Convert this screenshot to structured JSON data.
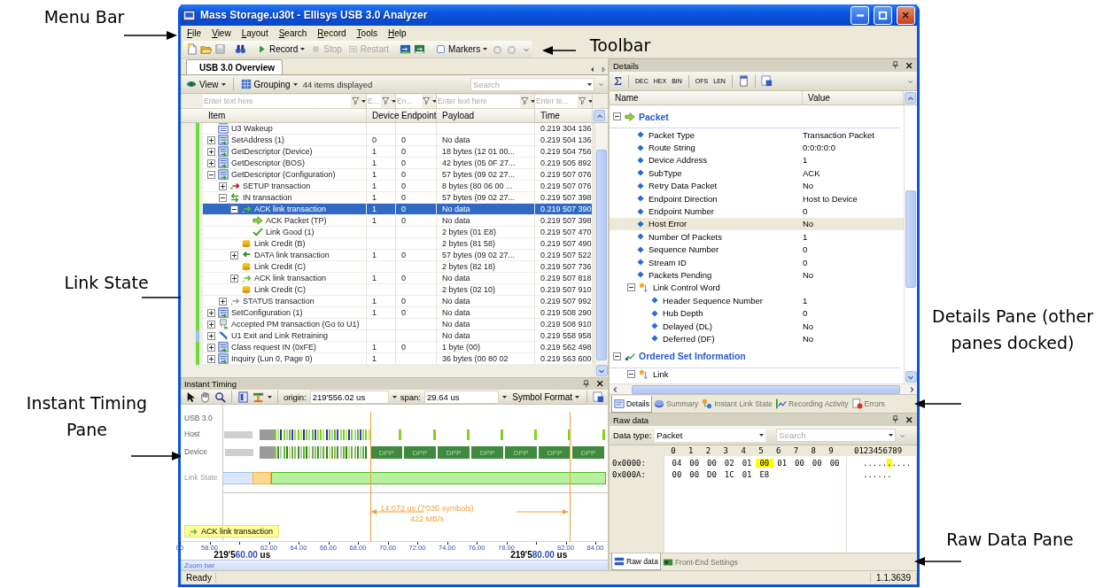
{
  "callouts": [
    {
      "text": "Menu Bar"
    },
    {
      "text": "Toolbar"
    },
    {
      "text": "Link State"
    },
    {
      "text": "Instant Timing Pane"
    },
    {
      "text": "Details Pane (other panes docked)"
    },
    {
      "text": "Raw Data Pane"
    }
  ],
  "window": {
    "title": "Mass Storage.u30t - Ellisys USB 3.0 Analyzer"
  },
  "menu": [
    "File",
    "View",
    "Layout",
    "Search",
    "Record",
    "Tools",
    "Help"
  ],
  "toolbar": [
    {
      "label": "Record",
      "disabled": false,
      "dropdown": true
    },
    {
      "label": "Stop",
      "disabled": true,
      "dropdown": false
    },
    {
      "label": "Restart",
      "disabled": true,
      "dropdown": false
    },
    {
      "label": "Markers",
      "disabled": false,
      "dropdown": true
    }
  ],
  "overview": {
    "tab": "USB 3.0 Overview",
    "view": "View",
    "grouping": "Grouping",
    "count": "44 items displayed",
    "search": {
      "placeholder": "Search"
    },
    "filters": [
      {
        "placeholder": "Enter text here"
      },
      {
        "placeholder": "E..."
      },
      {
        "placeholder": "En..."
      },
      {
        "placeholder": "Enter text here"
      },
      {
        "placeholder": "Enter te..."
      }
    ],
    "columns": [
      "Item",
      "Device",
      "Endpoint",
      "Payload",
      "Time"
    ],
    "rows": [
      {
        "item": "U3 Wakeup",
        "kind": "lfps",
        "expandable": false,
        "time": "0.219 304 136",
        "selected": false,
        "color": "#6edc3a"
      },
      {
        "item": "SetAddress (1)",
        "kind": "control",
        "expandable": true,
        "expanded": false,
        "device": "0",
        "endpoint": "0",
        "payload": "No data",
        "time": "0.219 504 136",
        "selected": false,
        "color": "#6edc3a"
      },
      {
        "item": "GetDescriptor (Device)",
        "kind": "control",
        "expandable": true,
        "expanded": false,
        "device": "1",
        "endpoint": "0",
        "payload": "18 bytes (12 01 00...",
        "time": "0.219 504 756",
        "selected": false,
        "color": "#6edc3a"
      },
      {
        "item": "GetDescriptor (BOS)",
        "kind": "control",
        "expandable": true,
        "expanded": false,
        "device": "1",
        "endpoint": "0",
        "payload": "42 bytes (05 0F 27...",
        "time": "0.219 505 892",
        "selected": false,
        "color": "#6edc3a"
      },
      {
        "item": "GetDescriptor (Configuration)",
        "kind": "control",
        "expandable": true,
        "expanded": true,
        "device": "1",
        "endpoint": "0",
        "payload": "57 bytes (09 02 27...",
        "time": "0.219 507 076",
        "selected": false,
        "color": "#6edc3a",
        "children": [
          {
            "item": "SETUP transaction",
            "kind": "setup",
            "expandable": true,
            "expanded": false,
            "device": "1",
            "endpoint": "0",
            "payload": "8 bytes (80 06 00 ...",
            "time": "0.219 507 076",
            "selected": false,
            "color": "#6edc3a"
          },
          {
            "item": "IN transaction",
            "kind": "in",
            "expandable": true,
            "expanded": true,
            "device": "1",
            "endpoint": "0",
            "payload": "57 bytes (09 02 27...",
            "time": "0.219 507 398",
            "selected": false,
            "color": "#6edc3a",
            "children": [
              {
                "item": "ACK link transaction",
                "kind": "ack-link",
                "expandable": true,
                "expanded": true,
                "device": "1",
                "endpoint": "0",
                "payload": "No data",
                "time": "0.219 507 390",
                "selected": true,
                "color": "#6edc3a",
                "children": [
                  {
                    "item": "ACK Packet (TP)",
                    "kind": "ack-packet",
                    "expandable": false,
                    "device": "1",
                    "endpoint": "0",
                    "payload": "No data",
                    "time": "0.219 507 398",
                    "selected": false,
                    "color": "#6edc3a"
                  },
                  {
                    "item": "Link Good (1)",
                    "kind": "link-good",
                    "expandable": false,
                    "payload": "2 bytes (01 E8)",
                    "time": "0.219 507 470",
                    "selected": false,
                    "color": "#6edc3a"
                  }
                ]
              },
              {
                "item": "Link Credit (B)",
                "kind": "link-credit",
                "expandable": false,
                "payload": "2 bytes (81 58)",
                "time": "0.219 507 490",
                "selected": false,
                "color": "#6edc3a"
              },
              {
                "item": "DATA link transaction",
                "kind": "data-link",
                "expandable": true,
                "expanded": false,
                "device": "1",
                "endpoint": "0",
                "payload": "57 bytes (09 02 27...",
                "time": "0.219 507 522",
                "selected": false,
                "color": "#6edc3a"
              },
              {
                "item": "Link Credit (C)",
                "kind": "link-credit",
                "expandable": false,
                "payload": "2 bytes (82 18)",
                "time": "0.219 507 736",
                "selected": false,
                "color": "#6edc3a"
              },
              {
                "item": "ACK link transaction",
                "kind": "ack-link",
                "expandable": true,
                "expanded": false,
                "device": "1",
                "endpoint": "0",
                "payload": "No data",
                "time": "0.219 507 818",
                "selected": false,
                "color": "#6edc3a"
              },
              {
                "item": "Link Credit (C)",
                "kind": "link-credit",
                "expandable": false,
                "payload": "2 bytes (02 10)",
                "time": "0.219 507 910",
                "selected": false,
                "color": "#6edc3a"
              }
            ]
          },
          {
            "item": "STATUS transaction",
            "kind": "status",
            "expandable": true,
            "expanded": false,
            "device": "1",
            "endpoint": "0",
            "payload": "No data",
            "time": "0.219 507 992",
            "selected": false,
            "color": "#6edc3a"
          }
        ]
      },
      {
        "item": "SetConfiguration (1)",
        "kind": "control",
        "expandable": true,
        "expanded": false,
        "device": "1",
        "endpoint": "0",
        "payload": "No data",
        "time": "0.219 508 290",
        "selected": false,
        "color": "#6edc3a"
      },
      {
        "item": "Accepted PM transaction (Go to U1)",
        "kind": "pm",
        "expandable": true,
        "expanded": false,
        "payload": "No data",
        "time": "0.219 508 910",
        "selected": false,
        "color": "#6edc3a"
      },
      {
        "item": "U1 Exit and Link Retraining",
        "kind": "u1-exit",
        "expandable": true,
        "expanded": false,
        "payload": "No data",
        "time": "0.219 558 958",
        "selected": false,
        "color": "#9ec2f0"
      },
      {
        "item": "Class request IN (0xFE)",
        "kind": "control",
        "expandable": true,
        "expanded": false,
        "device": "1",
        "endpoint": "0",
        "payload": "1 byte (00)",
        "time": "0.219 562 498",
        "selected": false,
        "color": "#6edc3a"
      },
      {
        "item": "Inquiry (Lun 0, Page 0)",
        "kind": "control",
        "expandable": true,
        "expanded": false,
        "device": "1",
        "payload": "36 bytes (00 80 02",
        "time": "0.219 563 600",
        "selected": false,
        "color": "#6edc3a"
      }
    ]
  },
  "timing": {
    "title": "Instant Timing",
    "origin_label": "origin:",
    "origin": "219'556.02 us",
    "span_label": "span:",
    "span": "29.64 us",
    "format": "Symbol Format",
    "lanes": [
      "USB 3.0",
      "Host",
      "Device",
      "Link State"
    ],
    "device_blocks": [
      "DPP",
      "DPP",
      "DPP",
      "DPP",
      "DPP",
      "DPP",
      "DPP"
    ],
    "measure": "14.072 us (7'036 symbols)",
    "rate": "422 MB/s",
    "tooltip": "ACK link transaction",
    "ticks": [
      {
        "kind": "minor",
        "label": "00"
      },
      {
        "kind": "minor",
        "label": "58.00"
      },
      {
        "kind": "major",
        "prefix": "219'5",
        "value": "60.00",
        "unit": "us"
      },
      {
        "kind": "minor",
        "label": "62.00"
      },
      {
        "kind": "minor",
        "label": "64.00"
      },
      {
        "kind": "minor",
        "label": "66.00"
      },
      {
        "kind": "minor",
        "label": "68.00"
      },
      {
        "kind": "minor",
        "label": "70.00"
      },
      {
        "kind": "minor",
        "label": "72.00"
      },
      {
        "kind": "minor",
        "label": "74.00"
      },
      {
        "kind": "minor",
        "label": "76.00"
      },
      {
        "kind": "minor",
        "label": "78.00"
      },
      {
        "kind": "major",
        "prefix": "219'5",
        "value": "80.00",
        "unit": "us"
      },
      {
        "kind": "minor",
        "label": "82.00"
      },
      {
        "kind": "minor",
        "label": "84.00"
      }
    ],
    "zoom_bar": "Zoom bar"
  },
  "details": {
    "title": "Details",
    "toolbar": [
      "DEC",
      "HEX",
      "BIN",
      "OFS",
      "LEN"
    ],
    "columns": [
      "Name",
      "Value"
    ],
    "tree": [
      {
        "label": "Packet",
        "kind": "section",
        "expanded": true,
        "selected": false,
        "children": [
          {
            "label": "Packet Type",
            "kind": "field",
            "value": "Transaction Packet",
            "selected": false
          },
          {
            "label": "Route String",
            "kind": "field",
            "value": "0:0:0:0:0",
            "selected": false
          },
          {
            "label": "Device Address",
            "kind": "field",
            "value": "1",
            "selected": false
          },
          {
            "label": "SubType",
            "kind": "field",
            "value": "ACK",
            "selected": false
          },
          {
            "label": "Retry Data Packet",
            "kind": "field",
            "value": "No",
            "selected": false
          },
          {
            "label": "Endpoint Direction",
            "kind": "field",
            "value": "Host to Device",
            "selected": false
          },
          {
            "label": "Endpoint Number",
            "kind": "field",
            "value": "0",
            "selected": false
          },
          {
            "label": "Host Error",
            "kind": "field",
            "value": "No",
            "selected": true
          },
          {
            "label": "Number Of Packets",
            "kind": "field",
            "value": "1",
            "selected": false
          },
          {
            "label": "Sequence Number",
            "kind": "field",
            "value": "0",
            "selected": false
          },
          {
            "label": "Stream ID",
            "kind": "field",
            "value": "0",
            "selected": false
          },
          {
            "label": "Packets Pending",
            "kind": "field",
            "value": "No",
            "selected": false
          },
          {
            "label": "Link Control Word",
            "kind": "group",
            "expanded": true,
            "selected": false,
            "children": [
              {
                "label": "Header Sequence Number",
                "kind": "field",
                "value": "1",
                "selected": false
              },
              {
                "label": "Hub Depth",
                "kind": "field",
                "value": "0",
                "selected": false
              },
              {
                "label": "Delayed (DL)",
                "kind": "field",
                "value": "No",
                "selected": false
              },
              {
                "label": "Deferred (DF)",
                "kind": "field",
                "value": "No",
                "selected": false
              }
            ]
          }
        ]
      },
      {
        "label": "Ordered Set Information",
        "kind": "section",
        "expanded": true,
        "selected": false,
        "children": [
          {
            "label": "Link",
            "kind": "group",
            "expanded": true,
            "selected": false
          }
        ]
      }
    ]
  },
  "dock_tabs": [
    {
      "label": "Details",
      "selected": true
    },
    {
      "label": "Summary",
      "selected": false
    },
    {
      "label": "Instant Link State",
      "selected": false
    },
    {
      "label": "Recording Activity",
      "selected": false
    },
    {
      "label": "Errors",
      "selected": false
    }
  ],
  "raw_data": {
    "title": "Raw data",
    "data_type_label": "Data type:",
    "data_type": "Packet",
    "search": {
      "placeholder": "Search"
    },
    "columns": [
      "0",
      "1",
      "2",
      "3",
      "4",
      "5",
      "6",
      "7",
      "8",
      "9"
    ],
    "ascii_header": "0123456789",
    "rows": [
      {
        "offset": "0x0000:",
        "bytes": [
          {
            "text": "04",
            "highlighted": false
          },
          {
            "text": "00",
            "highlighted": false
          },
          {
            "text": "00",
            "highlighted": false
          },
          {
            "text": "02",
            "highlighted": false
          },
          {
            "text": "01",
            "highlighted": false
          },
          {
            "text": "00",
            "highlighted": true
          },
          {
            "text": "01",
            "highlighted": false
          },
          {
            "text": "00",
            "highlighted": false
          },
          {
            "text": "00",
            "highlighted": false
          },
          {
            "text": "00",
            "highlighted": false
          }
        ],
        "ascii": ".........."
      },
      {
        "offset": "0x000A:",
        "bytes": [
          {
            "text": "00",
            "highlighted": false
          },
          {
            "text": "00",
            "highlighted": false
          },
          {
            "text": "D0",
            "highlighted": false
          },
          {
            "text": "1C",
            "highlighted": false
          },
          {
            "text": "01",
            "highlighted": false
          },
          {
            "text": "E8",
            "highlighted": false
          }
        ],
        "ascii": "......"
      }
    ]
  },
  "bottom_tabs": [
    {
      "label": "Raw data",
      "selected": true
    },
    {
      "label": "Front-End Settings",
      "selected": false
    }
  ],
  "status_bar": {
    "text": "Ready",
    "version": "1.1.3639"
  }
}
